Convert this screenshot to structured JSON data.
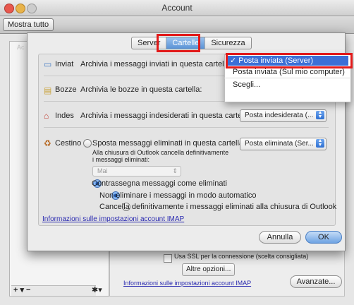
{
  "window": {
    "title": "Account"
  },
  "toolbar": {
    "show_all": "Mostra tutto"
  },
  "sheet": {
    "tabs": [
      {
        "label": "Server"
      },
      {
        "label": "Cartelle"
      },
      {
        "label": "Sicurezza"
      }
    ],
    "rows": {
      "sent": {
        "name": "Inviat",
        "desc": "Archivia i messaggi inviati in questa cartella:"
      },
      "drafts": {
        "name": "Bozze",
        "desc": "Archivia le bozze in questa cartella:"
      },
      "junk": {
        "name": "Indes",
        "desc": "Archivia i messaggi indesiderati in questa cartella:",
        "popup": "Posta indesiderata (..."
      },
      "trash": {
        "name": "Cestino",
        "move_label": "Sposta messaggi eliminati in questa cartella:",
        "popup": "Posta eliminata (Ser...",
        "note_line1": "Alla chiusura di Outlook cancella definitivamente",
        "note_line2": "i messaggi eliminati:",
        "never": "Mai",
        "mark_label": "Contrassegna messaggi come eliminati",
        "opt_keep": "Non eliminare i messaggi in modo automatico",
        "opt_purge": "Cancella definitivamente i messaggi eliminati alla chiusura di Outlook"
      }
    },
    "info_link": "Informazioni sulle impostazioni account IMAP",
    "cancel": "Annulla",
    "ok": "OK"
  },
  "menu": {
    "items": [
      {
        "label": "✓ Posta inviata (Server)"
      },
      {
        "label": "Posta inviata (Sul mio computer)"
      },
      {
        "label": "Scegli..."
      }
    ]
  },
  "background": {
    "ssl_label": "Usa SSL per la connessione (scelta consigliata)",
    "more_options": "Altre opzioni...",
    "info_link": "Informazioni sulle impostazioni account IMAP",
    "advanced": "Avanzate...",
    "list_controls": "+ ▾ −"
  }
}
